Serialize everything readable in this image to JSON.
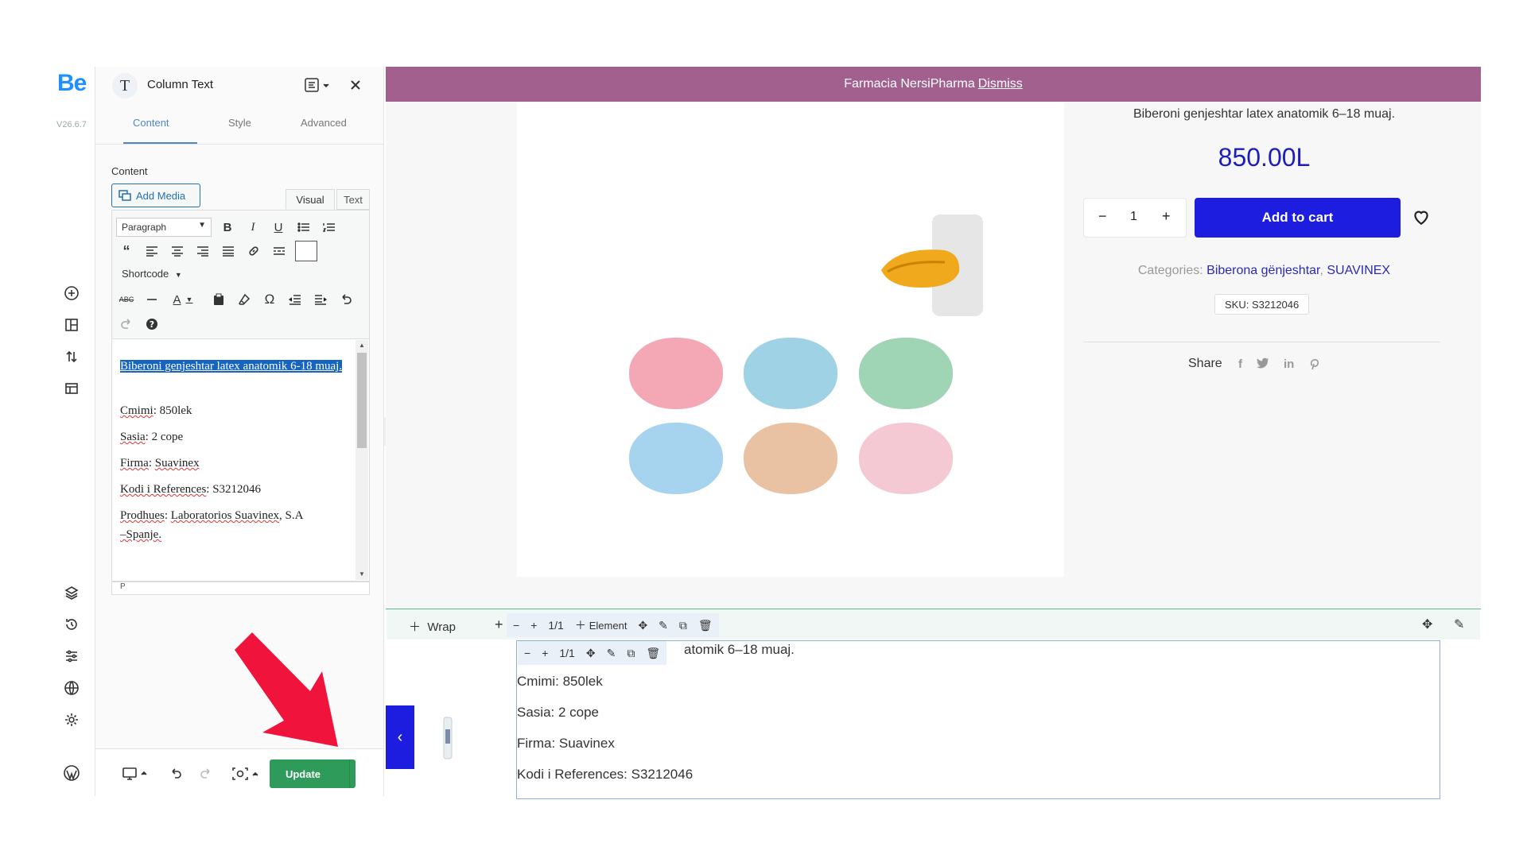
{
  "app": {
    "logo": "Be",
    "version": "V26.6.7"
  },
  "panel": {
    "title": "Column Text",
    "avatar_letter": "T",
    "tabs": [
      {
        "label": "Content",
        "active": true
      },
      {
        "label": "Style",
        "active": false
      },
      {
        "label": "Advanced",
        "active": false
      }
    ],
    "content_label": "Content",
    "add_media_label": "Add Media",
    "editor_tabs": [
      {
        "label": "Visual",
        "active": true
      },
      {
        "label": "Text",
        "active": false
      }
    ],
    "format_select": "Paragraph",
    "shortcode_label": "Shortcode",
    "editor_paragraphs": {
      "p1": "Biberoni genjeshtar latex anatomik 6-18 muaj.",
      "p2_label": "Cmimi",
      "p2_value": ": 850lek",
      "p3_label": "Sasia",
      "p3_value": ": 2 cope",
      "p4_label": "Firma",
      "p4_value": "Suavinex",
      "p5_label": "Kodi i References",
      "p5_value": ": S3212046",
      "p6_label": "Prodhues",
      "p6_value": "Laboratorios Suavinex",
      "p6_rest": ", S.A",
      "p7": "–Spanje."
    },
    "status_path": "P",
    "update_label": "Update"
  },
  "notice": {
    "text": "Farmacia NersiPharma",
    "dismiss": "Dismiss"
  },
  "product": {
    "short_description": "Biberoni genjeshtar latex anatomik 6–18 muaj.",
    "price": "850.00L",
    "quantity": "1",
    "add_to_cart": "Add to cart",
    "categories_label": "Categories:",
    "category_1": "Biberona gënjeshtar",
    "category_2": "SUAVINEX",
    "sku": "SKU: S3212046",
    "share_label": "Share"
  },
  "builder": {
    "wrap_label": "Wrap",
    "ratio": "1/1",
    "element_label": "Element",
    "column_lines": {
      "l1": "atomik 6–18 muaj.",
      "l2": "Cmimi: 850lek",
      "l3": "Sasia: 2 cope",
      "l4": "Firma: Suavinex",
      "l5": "Kodi i References: S3212046"
    }
  },
  "colors": {
    "notice_bg": "#a2608f",
    "accent_blue": "#1d1de0",
    "update_green": "#2e9b5b",
    "arrow_red": "#f0143c"
  }
}
